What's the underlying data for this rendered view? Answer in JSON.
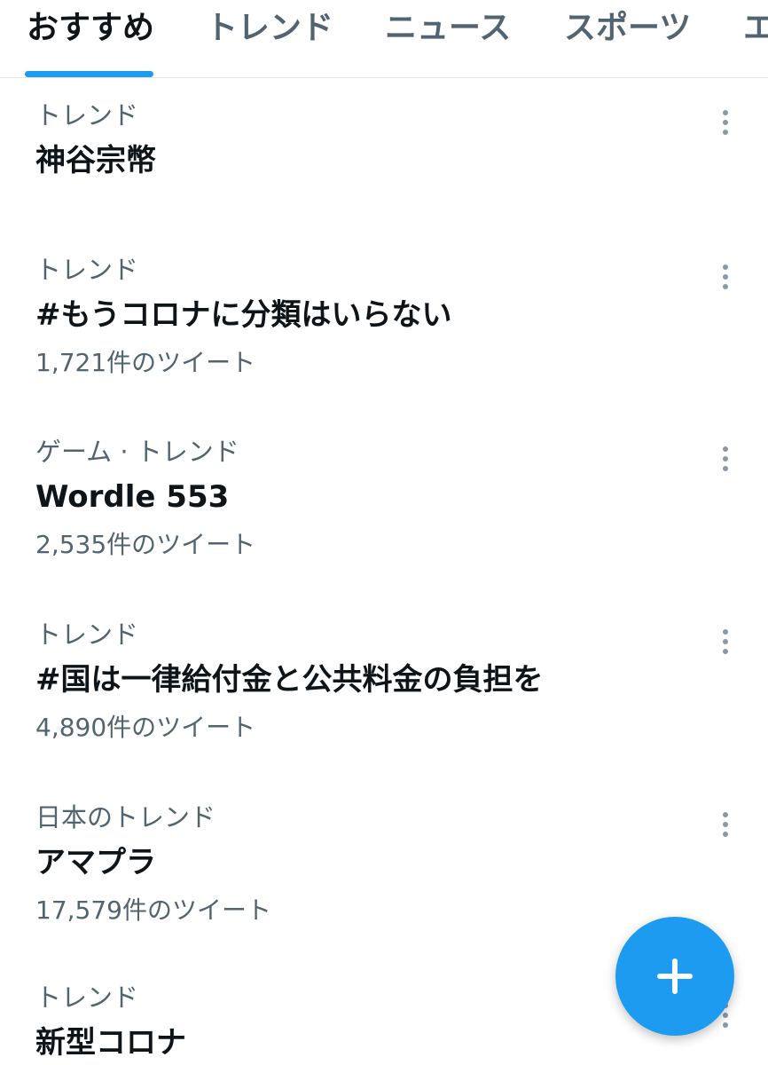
{
  "tabs": [
    {
      "label": "おすすめ",
      "active": true
    },
    {
      "label": "トレンド",
      "active": false
    },
    {
      "label": "ニュース",
      "active": false
    },
    {
      "label": "スポーツ",
      "active": false
    },
    {
      "label": "エ",
      "active": false
    }
  ],
  "trends": [
    {
      "context": "トレンド",
      "title": "神谷宗幣",
      "count": ""
    },
    {
      "context": "トレンド",
      "title": "#もうコロナに分類はいらない",
      "count": "1,721件のツイート"
    },
    {
      "context": "ゲーム · トレンド",
      "title": "Wordle 553",
      "count": "2,535件のツイート"
    },
    {
      "context": "トレンド",
      "title": "#国は一律給付金と公共料金の負担を",
      "count": "4,890件のツイート"
    },
    {
      "context": "日本のトレンド",
      "title": "アマプラ",
      "count": "17,579件のツイート"
    },
    {
      "context": "トレンド",
      "title": "新型コロナ",
      "count": ""
    }
  ],
  "colors": {
    "accent": "#1d9bf0",
    "text_primary": "#0f1419",
    "text_secondary": "#536471"
  },
  "icons": {
    "more": "more-vertical-icon",
    "compose": "plus-icon"
  }
}
